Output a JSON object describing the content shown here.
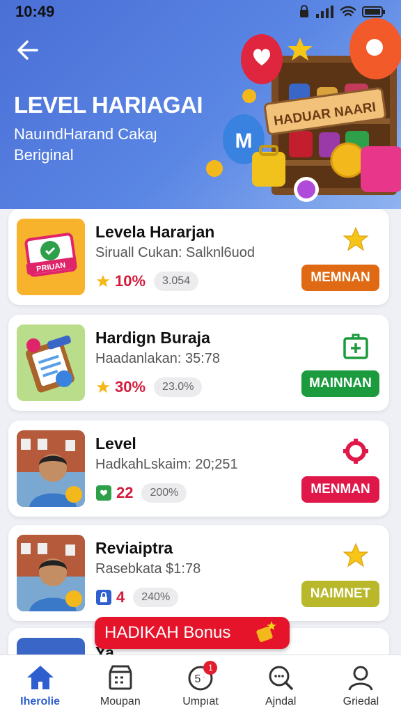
{
  "status_bar": {
    "time": "10:49"
  },
  "header": {
    "title": "LEVEL HARIAGAI",
    "subtitle_line1": "NauındHarand Cakaȷ",
    "subtitle_line2": "Beriginal",
    "sign_text": "HADUAR NAARI"
  },
  "cards": [
    {
      "title": "Levela Hararjan",
      "subtitle": "Siruall Cukan: Salknl6uod",
      "percent": "10%",
      "pill": "3.054",
      "button": "MEMNAN",
      "button_color": "#e06a14",
      "thumb_label": "PRIUAN"
    },
    {
      "title": "Hardign Buraja",
      "subtitle": "Haadanlakan: 35:78",
      "percent": "30%",
      "pill": "23.0%",
      "button": "MAINNAN",
      "button_color": "#1c9a3e"
    },
    {
      "title": "Level",
      "subtitle": "HadkahLskaim: 20;251",
      "percent": "22",
      "pill": "200%",
      "button": "MENMAN",
      "button_color": "#e0184a"
    },
    {
      "title": "Reviaiptra",
      "subtitle": "Rasebkata $1:78",
      "percent": "4",
      "pill": "240%",
      "button": "NAIMNET",
      "button_color": "#b8b82a"
    }
  ],
  "bonus": {
    "label": "HADIKAH Bonus"
  },
  "partial_card": {
    "title": "Ya"
  },
  "nav": [
    {
      "label": "Iherolie"
    },
    {
      "label": "Moupan"
    },
    {
      "label": "Umpıat",
      "badge": "1"
    },
    {
      "label": "Ajndal"
    },
    {
      "label": "Griedal"
    }
  ],
  "colors": {
    "header": "#4a6fd6",
    "active_nav": "#2f5fcf",
    "bonus": "#e5142a"
  }
}
